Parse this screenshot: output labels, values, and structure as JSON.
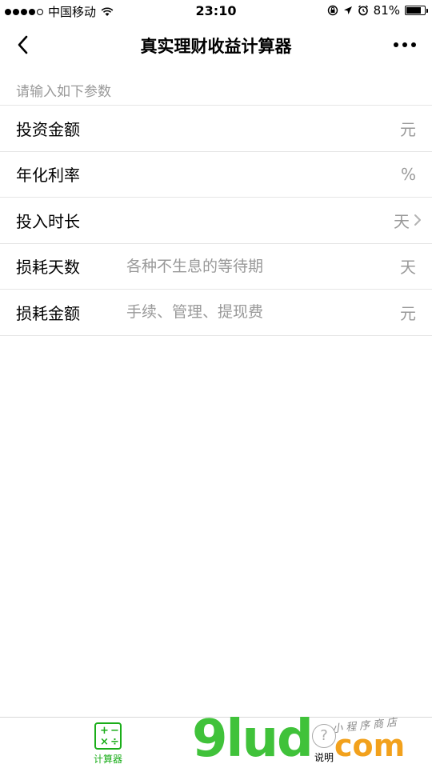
{
  "status_bar": {
    "carrier": "中国移动",
    "time": "23:10",
    "battery": "81%",
    "battery_level": 0.81
  },
  "nav": {
    "title": "真实理财收益计算器"
  },
  "form": {
    "section_label": "请输入如下参数",
    "rows": [
      {
        "label": "投资金额",
        "placeholder": "",
        "unit": "元"
      },
      {
        "label": "年化利率",
        "placeholder": "",
        "unit": "%"
      },
      {
        "label": "投入时长",
        "placeholder": "",
        "unit": "天"
      },
      {
        "label": "损耗天数",
        "placeholder": "各种不生息的等待期",
        "unit": "天"
      },
      {
        "label": "损耗金额",
        "placeholder": "手续、管理、提现费",
        "unit": "元"
      }
    ]
  },
  "tabbar": {
    "tabs": [
      {
        "label": "计算器",
        "icon": "calculator-icon",
        "active": true
      },
      {
        "label": "说明",
        "icon": "help-icon",
        "active": false
      }
    ],
    "accent_color": "#1aad19"
  },
  "watermark": {
    "brand": "9lud",
    "suffix": "com",
    "tagline": "小程序商店"
  }
}
